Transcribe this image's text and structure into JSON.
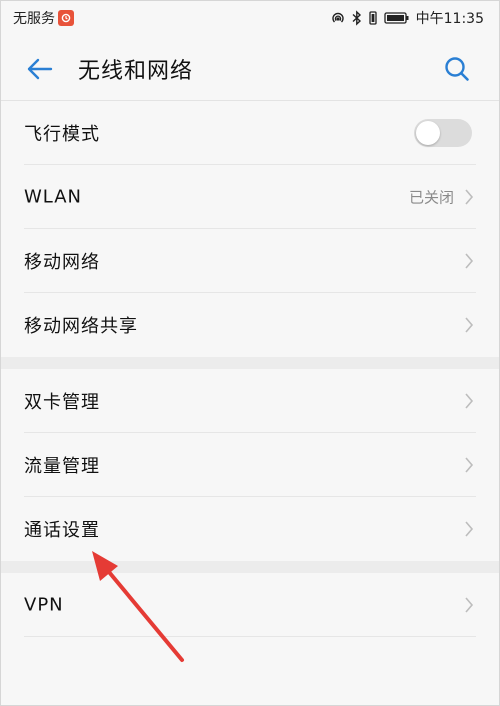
{
  "status_bar": {
    "carrier": "无服务",
    "time": "中午11:35"
  },
  "header": {
    "title": "无线和网络"
  },
  "groups": [
    {
      "items": [
        {
          "label": "飞行模式",
          "control": "toggle",
          "toggle_on": false
        },
        {
          "label": "WLAN",
          "value": "已关闭"
        },
        {
          "label": "移动网络"
        },
        {
          "label": "移动网络共享"
        }
      ]
    },
    {
      "items": [
        {
          "label": "双卡管理"
        },
        {
          "label": "流量管理"
        },
        {
          "label": "通话设置"
        }
      ]
    },
    {
      "items": [
        {
          "label": "VPN"
        }
      ]
    }
  ],
  "colors": {
    "accent": "#2a7fd4",
    "annotation_arrow": "#e53b35"
  }
}
